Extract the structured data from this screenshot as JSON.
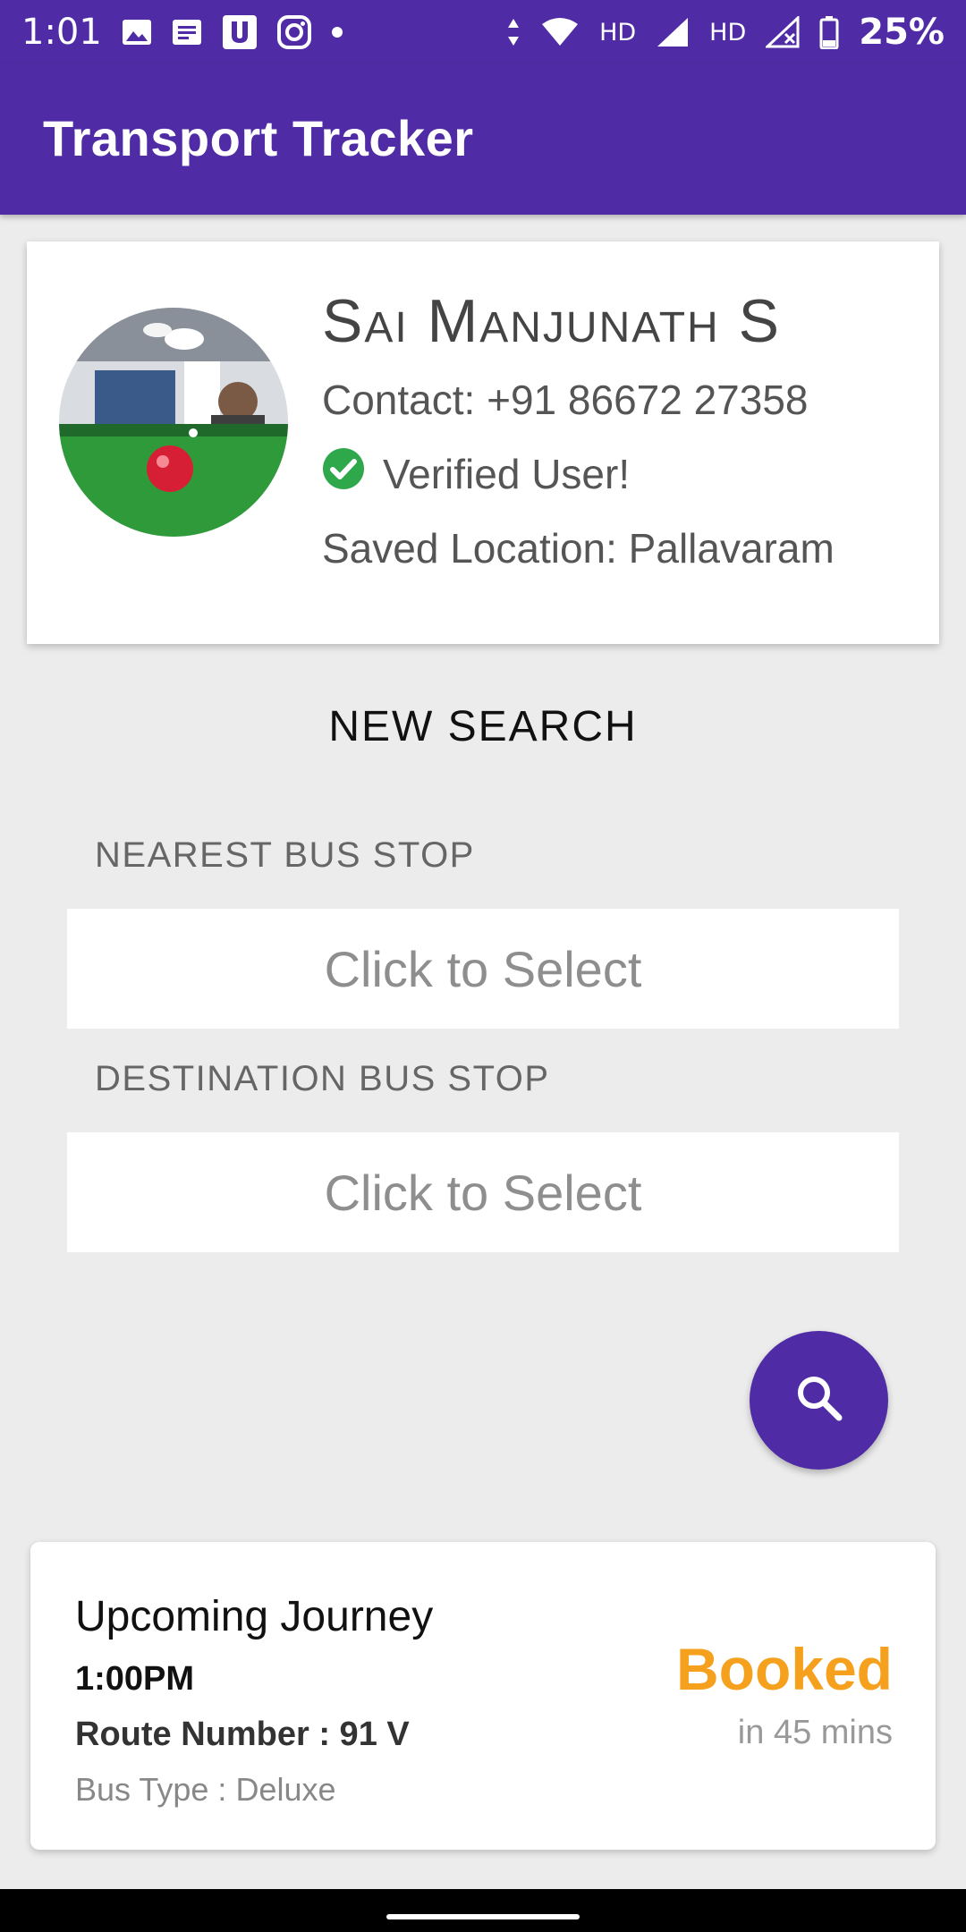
{
  "status_bar": {
    "time": "1:01",
    "hd1": "HD",
    "hd2": "HD",
    "battery": "25%",
    "icons": [
      "image-icon",
      "message-icon",
      "u-app-icon",
      "instagram-icon",
      "dot-icon",
      "data-arrows-icon",
      "wifi-icon",
      "signal-icon",
      "signal-x-icon",
      "battery-icon"
    ]
  },
  "app_bar": {
    "title": "Transport Tracker"
  },
  "profile": {
    "name": "Sai Manjunath S",
    "contact": "Contact: +91 86672 27358",
    "verified": "Verified User!",
    "location": "Saved Location: Pallavaram"
  },
  "search": {
    "title": "NEW SEARCH",
    "nearest_label": "NEAREST BUS STOP",
    "nearest_value": "Click to Select",
    "destination_label": "DESTINATION BUS STOP",
    "destination_value": "Click to Select"
  },
  "journey": {
    "title": "Upcoming Journey",
    "time": "1:00PM",
    "route": "Route Number : 91 V",
    "bus_type": "Bus Type : Deluxe",
    "status": "Booked",
    "eta": "in 45 mins"
  },
  "colors": {
    "primary": "#4f2ca6",
    "background": "#ececec",
    "booked": "#f5a11e",
    "verified": "#2ea84a"
  }
}
